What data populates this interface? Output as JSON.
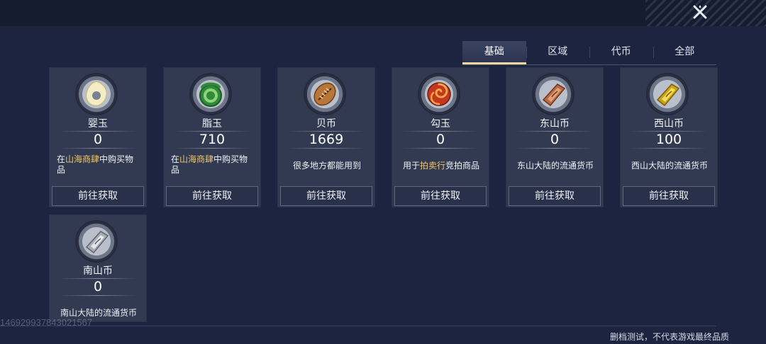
{
  "header": {
    "close_icon": "close-icon"
  },
  "tabs": [
    {
      "label": "基础",
      "active": true
    },
    {
      "label": "区域",
      "active": false
    },
    {
      "label": "代币",
      "active": false
    },
    {
      "label": "全部",
      "active": false
    }
  ],
  "currencies": [
    {
      "name": "婴玉",
      "count": "0",
      "icon": "jade-disc-icon",
      "desc_pre": "在",
      "desc_hl": "山海商肆",
      "desc_post": "中购买物品",
      "button": "前往获取"
    },
    {
      "name": "脂玉",
      "count": "710",
      "icon": "green-jade-coil-icon",
      "desc_pre": "在",
      "desc_hl": "山海商肆",
      "desc_post": "中购买物品",
      "button": "前往获取"
    },
    {
      "name": "贝币",
      "count": "1669",
      "icon": "shell-coin-icon",
      "desc": "很多地方都能用到",
      "button": "前往获取"
    },
    {
      "name": "勾玉",
      "count": "0",
      "icon": "red-magatama-icon",
      "desc_pre": "用于",
      "desc_hl": "拍卖行",
      "desc_post": "竞拍商品",
      "button": "前往获取"
    },
    {
      "name": "东山币",
      "count": "0",
      "icon": "copper-ingot-icon",
      "desc": "东山大陆的流通货币",
      "button": "前往获取"
    },
    {
      "name": "西山币",
      "count": "100",
      "icon": "gold-ingot-icon",
      "desc": "西山大陆的流通货币",
      "button": "前往获取"
    },
    {
      "name": "南山币",
      "count": "0",
      "icon": "silver-ingot-icon",
      "desc": "南山大陆的流通货币"
    }
  ],
  "footer": {
    "watermark": "1469299378430215​67",
    "notice": "删档测试，不代表游戏最终品质"
  },
  "colors": {
    "highlight": "#f0c66a",
    "tab_active_underline": "#f1d79b",
    "background": "#1c2440"
  }
}
